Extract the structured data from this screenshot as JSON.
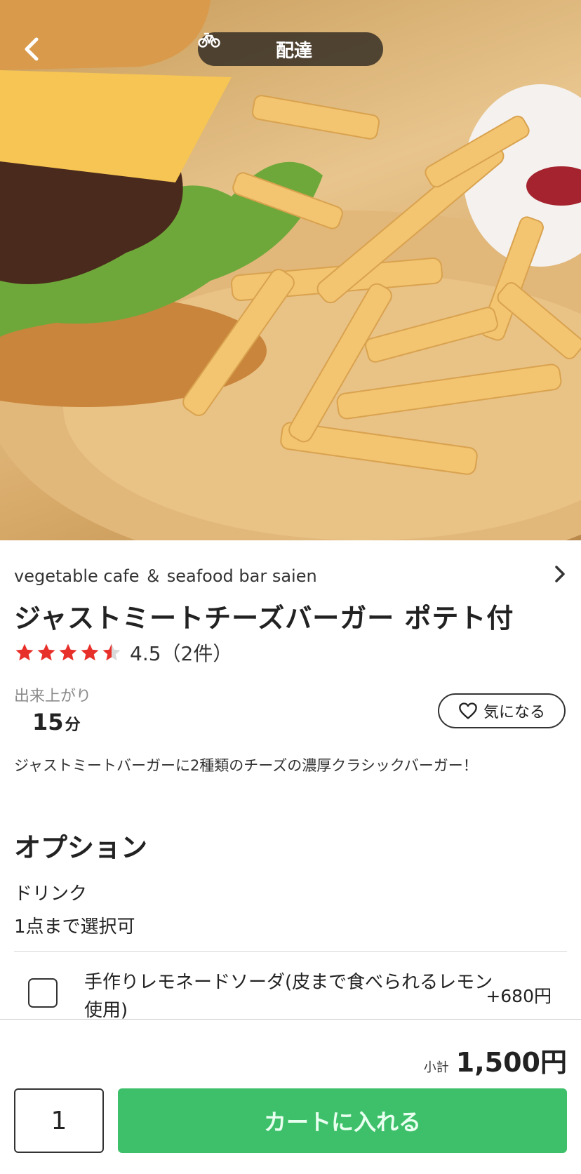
{
  "header": {
    "mode_label": "配達",
    "mode_icon": "bicycle-icon",
    "back_icon": "chevron-left-icon"
  },
  "item": {
    "shop_name": "vegetable cafe ＆ seafood bar saien",
    "title": "ジャストミートチーズバーガー ポテト付",
    "rating_value": 4.5,
    "rating_text": "4.5（2件）",
    "ready_label": "出来上がり",
    "ready_minutes": "15",
    "ready_unit": "分",
    "favorite_label": "気になる",
    "description": "ジャストミートバーガーに2種類のチーズの濃厚クラシックバーガー！"
  },
  "options": {
    "heading": "オプション",
    "group_name": "ドリンク",
    "group_limit": "1点まで選択可",
    "items": [
      {
        "label": "手作りレモネードソーダ(皮まで食べられるレモン使用)",
        "price": "+680円",
        "checked": false
      }
    ]
  },
  "footer": {
    "subtotal_label": "小計",
    "subtotal_amount": "1,500円",
    "quantity": "1",
    "cart_button": "カートに入れる"
  },
  "colors": {
    "accent_green": "#3ec06a",
    "star_red": "#e8302a"
  }
}
